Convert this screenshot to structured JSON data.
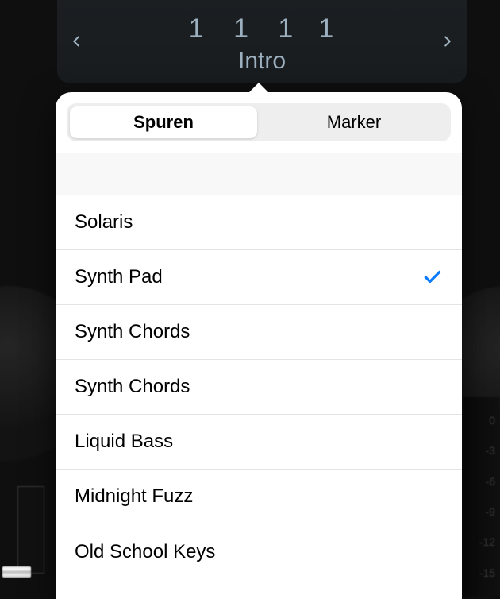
{
  "display": {
    "counter_group": "1  1  1",
    "counter_last": "1",
    "section": "Intro"
  },
  "segmented": {
    "tracks": "Spuren",
    "markers": "Marker"
  },
  "tracks": [
    {
      "label": "Solaris",
      "selected": false
    },
    {
      "label": "Synth Pad",
      "selected": true
    },
    {
      "label": "Synth Chords",
      "selected": false
    },
    {
      "label": "Synth Chords",
      "selected": false
    },
    {
      "label": "Liquid Bass",
      "selected": false
    },
    {
      "label": "Midnight Fuzz",
      "selected": false
    },
    {
      "label": "Old School Keys",
      "selected": false
    }
  ],
  "meter_ticks": [
    "0",
    "-3",
    "-6",
    "-9",
    "-12",
    "-15"
  ]
}
